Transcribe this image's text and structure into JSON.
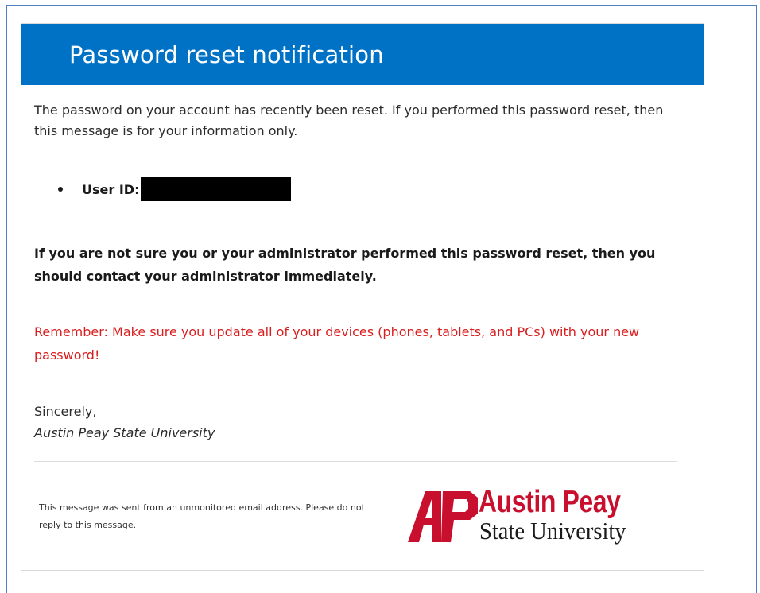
{
  "email": {
    "header_title": "Password reset notification",
    "intro": "The password on your account has recently been reset. If you performed this password reset, then this message is for your information only.",
    "user_id_label": "User ID:",
    "warning": "If you are not sure you or your administrator performed this password reset, then you should contact your administrator immediately.",
    "reminder": "Remember: Make sure you update all of your devices (phones, tablets, and PCs) with your new password!",
    "closing": "Sincerely,",
    "signature": "Austin Peay State University",
    "footer_note": "This message was sent from an unmonitored email address. Please do not reply to this message."
  },
  "logo": {
    "line1": "Austin Peay",
    "line2": "State University",
    "brand_red": "#c8102e"
  },
  "colors": {
    "header_blue": "#0072c6",
    "reminder_red": "#d81e1e"
  }
}
